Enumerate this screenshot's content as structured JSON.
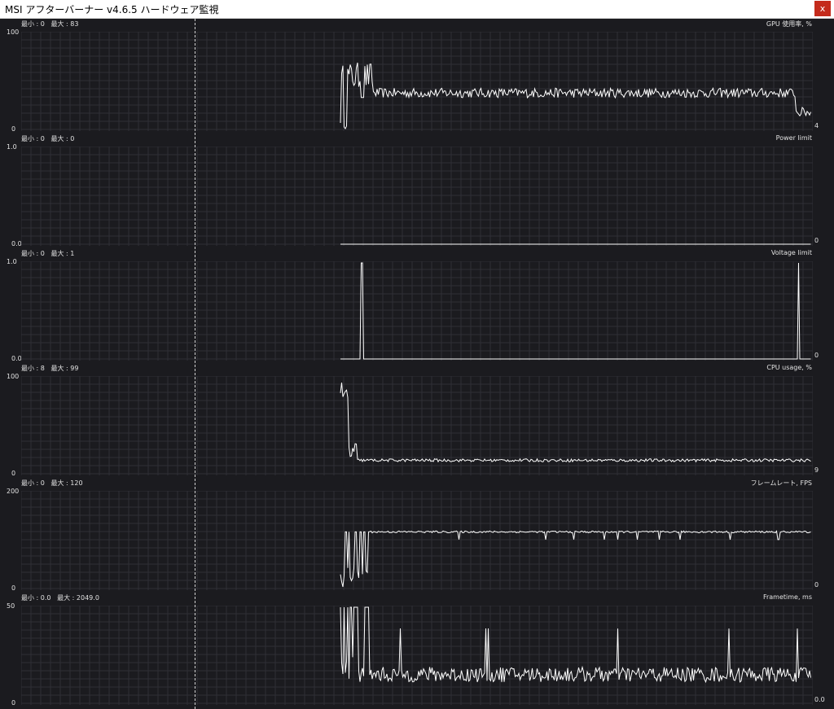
{
  "window": {
    "title": "MSI アフターバーナー v4.6.5 ハードウェア監視",
    "close_label": "x"
  },
  "colors": {
    "background": "#1b1b1f",
    "grid": "#2f2f35",
    "trace": "#ffffff",
    "close": "#c42b1c"
  },
  "graphs": [
    {
      "title": "GPU 使用率, %",
      "stats": "最小 : 0   最大 : 83",
      "y_max_label": "100",
      "y_min_label": "0",
      "current": "4",
      "ylim": [
        0,
        100
      ],
      "profile": "gpu"
    },
    {
      "title": "Power limit",
      "stats": "最小 : 0   最大 : 0",
      "y_max_label": "1.0",
      "y_min_label": "0.0",
      "current": "0",
      "ylim": [
        0,
        1
      ],
      "profile": "flat"
    },
    {
      "title": "Voltage limit",
      "stats": "最小 : 0   最大 : 1",
      "y_max_label": "1.0",
      "y_min_label": "0.0",
      "current": "0",
      "ylim": [
        0,
        1
      ],
      "profile": "pulse"
    },
    {
      "title": "CPU usage, %",
      "stats": "最小 : 8   最大 : 99",
      "y_max_label": "100",
      "y_min_label": "0",
      "current": "9",
      "ylim": [
        0,
        100
      ],
      "profile": "cpu"
    },
    {
      "title": "フレームレート, FPS",
      "stats": "最小 : 0   最大 : 120",
      "y_max_label": "200",
      "y_min_label": "0",
      "current": "0",
      "ylim": [
        0,
        200
      ],
      "profile": "fps"
    },
    {
      "title": "Frametime, ms",
      "stats": "最小 : 0.0   最大 : 2049.0",
      "y_max_label": "50",
      "y_min_label": "0",
      "current": "0.0",
      "ylim": [
        0,
        50
      ],
      "profile": "frametime"
    }
  ]
}
